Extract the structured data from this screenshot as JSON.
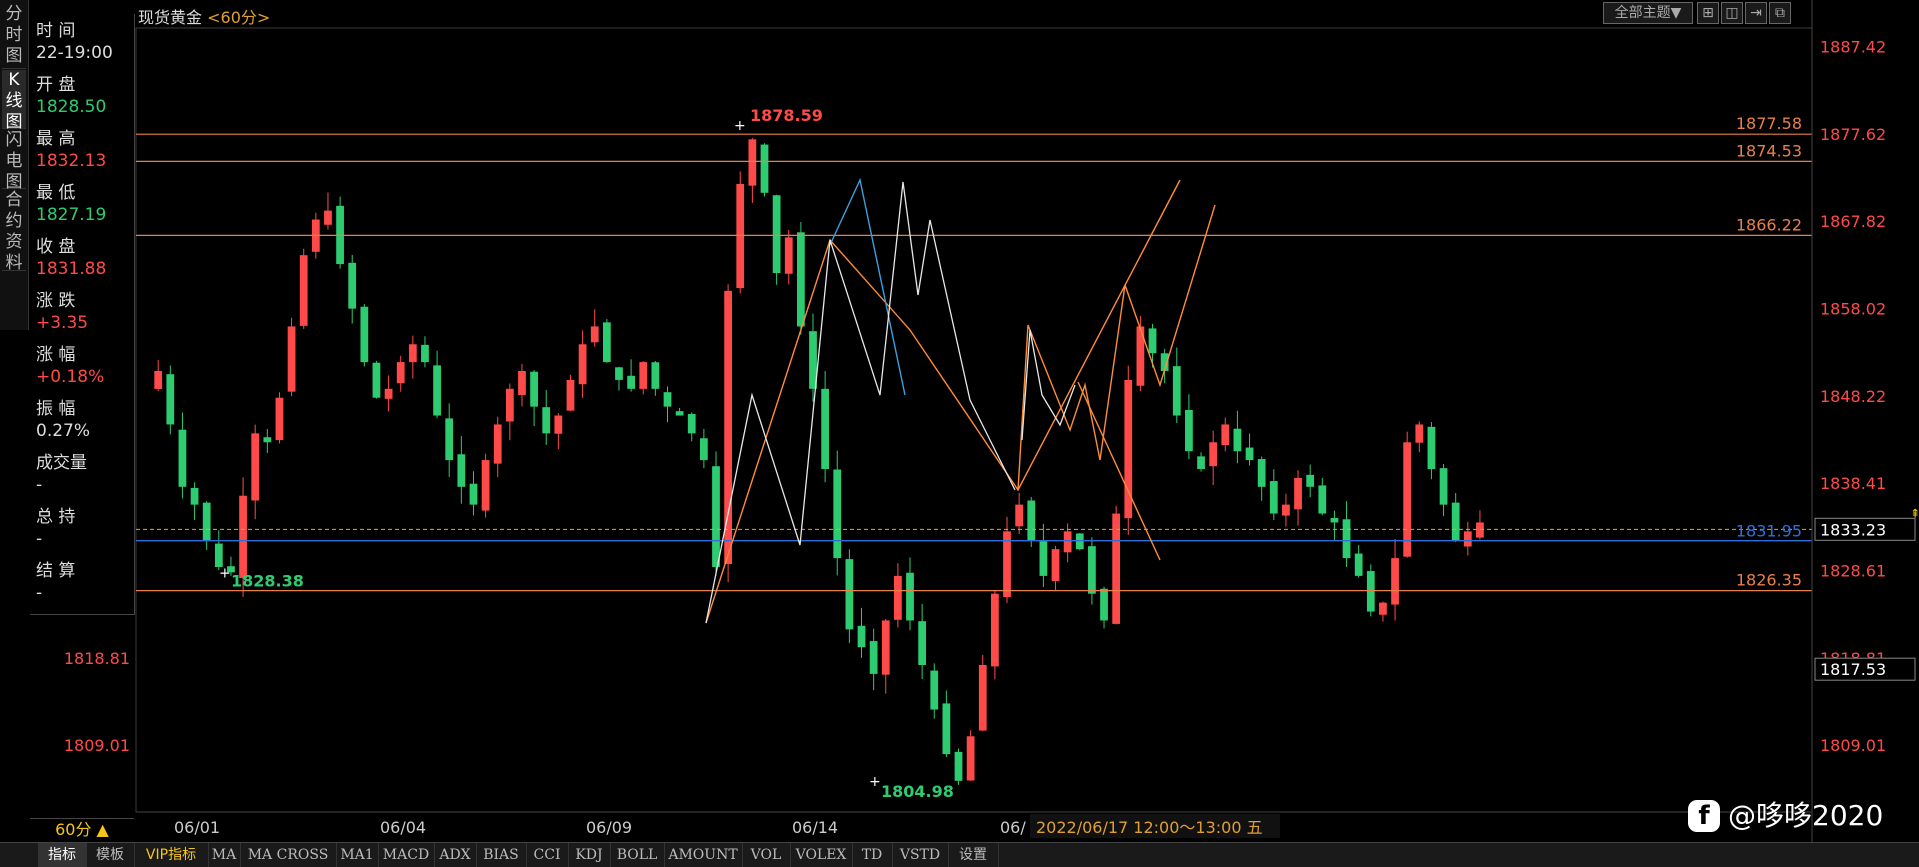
{
  "side_tabs": [
    "分时图",
    "K线图",
    "闪电图",
    "合约资料"
  ],
  "info_panel": [
    {
      "label": "时 间",
      "value": "22-19:00",
      "color": "#dddddd"
    },
    {
      "label": "开 盘",
      "value": "1828.50",
      "color": "#2ecc71"
    },
    {
      "label": "最 高",
      "value": "1832.13",
      "color": "#ff4a4a"
    },
    {
      "label": "最 低",
      "value": "1827.19",
      "color": "#2ecc71"
    },
    {
      "label": "收 盘",
      "value": "1831.88",
      "color": "#ff4a4a"
    },
    {
      "label": "涨 跌",
      "value": "+3.35",
      "color": "#ff4a4a"
    },
    {
      "label": "涨 幅",
      "value": "+0.18%",
      "color": "#ff4a4a"
    },
    {
      "label": "振 幅",
      "value": "0.27%",
      "color": "#dddddd"
    },
    {
      "label": "成交量",
      "value": "-",
      "color": "#dddddd"
    },
    {
      "label": "总 持",
      "value": "-",
      "color": "#dddddd"
    },
    {
      "label": "结 算",
      "value": "-",
      "color": "#dddddd"
    }
  ],
  "chart_header": {
    "symbol": "现货黄金",
    "period": "<60分>"
  },
  "top_buttons": {
    "theme_select": "全部主题▼",
    "icons": [
      "layout-grid-icon",
      "split-view-icon",
      "pin-icon",
      "expand-icon"
    ]
  },
  "colors": {
    "up": "#ff4a4a",
    "down": "#2ecc71",
    "line_level": "#e8804a",
    "line_current": "#2a6fdb",
    "axis_label": "#ff4a4a"
  },
  "chart_data": {
    "type": "candlestick",
    "title": "现货黄金",
    "period": "60分",
    "y_ticks_right": [
      "1887.42",
      "1877.62",
      "1867.82",
      "1858.02",
      "1848.22",
      "1838.41",
      "1828.61",
      "1818.81",
      "1809.01"
    ],
    "y_ticks_left": [
      "1818.81",
      "1809.01"
    ],
    "ylim": [
      1801.5,
      1889.5
    ],
    "x_ticks": [
      "06/01",
      "06/04",
      "06/09",
      "06/14",
      "06/"
    ],
    "cursor_time_label": "2022/06/17 12:00～13:00 五",
    "current_price": "1833.23",
    "hover_price": "1817.53",
    "horizontal_levels": [
      {
        "value": 1877.58,
        "label": "1877.58"
      },
      {
        "value": 1874.53,
        "label": "1874.53"
      },
      {
        "value": 1866.22,
        "label": "1866.22"
      },
      {
        "value": 1826.35,
        "label": "1826.35"
      }
    ],
    "current_line": {
      "value": 1831.95,
      "label": "1831.95"
    },
    "marked_prices": [
      {
        "label": "1878.59",
        "value": 1878.59
      },
      {
        "label": "1828.38",
        "value": 1828.38
      },
      {
        "label": "1804.98",
        "value": 1804.98
      }
    ],
    "close_path": [
      1849,
      1851,
      1845,
      1838,
      1836,
      1832,
      1829,
      1828.4,
      1837,
      1844,
      1843,
      1848,
      1856,
      1864,
      1868,
      1869,
      1863,
      1858,
      1852,
      1848,
      1849,
      1852,
      1854,
      1852,
      1846,
      1841,
      1838,
      1836,
      1841,
      1845,
      1849,
      1851,
      1847,
      1844,
      1846,
      1850,
      1854,
      1856,
      1852,
      1850,
      1849,
      1852,
      1849,
      1847,
      1846,
      1844,
      1841,
      1829,
      1860,
      1872,
      1877,
      1871,
      1862,
      1866,
      1856,
      1849,
      1840,
      1830,
      1822,
      1820,
      1817,
      1823,
      1828,
      1823,
      1818,
      1813,
      1808,
      1805,
      1810,
      1818,
      1826,
      1833,
      1836,
      1832,
      1828,
      1831,
      1833,
      1831,
      1826,
      1823,
      1835,
      1850,
      1856,
      1853,
      1851,
      1846,
      1842,
      1840,
      1843,
      1845,
      1842,
      1841,
      1838,
      1835,
      1836,
      1839,
      1838,
      1835,
      1834,
      1830,
      1828,
      1824,
      1825,
      1830,
      1843,
      1845,
      1840,
      1836,
      1832,
      1833,
      1834
    ],
    "dashed_level": 1833.23
  },
  "drawing_lines": {
    "orange": [
      [
        [
          706,
          623
        ],
        [
          830,
          240
        ],
        [
          910,
          330
        ],
        [
          1018,
          490
        ],
        [
          1180,
          180
        ]
      ],
      [
        [
          1018,
          490
        ],
        [
          1028,
          325
        ],
        [
          1048,
          375
        ],
        [
          1070,
          430
        ],
        [
          1085,
          385
        ],
        [
          1100,
          460
        ],
        [
          1125,
          285
        ],
        [
          1160,
          385
        ],
        [
          1215,
          205
        ]
      ],
      [
        [
          1078,
          382
        ],
        [
          1160,
          560
        ]
      ]
    ],
    "blue": [
      [
        [
          830,
          245
        ],
        [
          860,
          180
        ],
        [
          905,
          395
        ]
      ]
    ],
    "white": [
      [
        [
          706,
          623
        ],
        [
          752,
          395
        ],
        [
          800,
          545
        ],
        [
          830,
          240
        ],
        [
          880,
          395
        ],
        [
          903,
          182
        ],
        [
          918,
          295
        ],
        [
          930,
          220
        ],
        [
          970,
          400
        ],
        [
          1015,
          490
        ]
      ],
      [
        [
          1022,
          440
        ],
        [
          1030,
          330
        ],
        [
          1042,
          395
        ],
        [
          1060,
          425
        ],
        [
          1075,
          385
        ]
      ]
    ]
  },
  "bottom_tabs": [
    "指标",
    "模板",
    "VIP指标",
    "MA",
    "MA CROSS",
    "MA1",
    "MACD",
    "ADX",
    "BIAS",
    "CCI",
    "KDJ",
    "BOLL",
    "AMOUNT",
    "VOL",
    "VOLEX",
    "TD",
    "VSTD",
    "设置"
  ],
  "period_button": "60分 ▲",
  "watermark": {
    "icon": "f",
    "text": "@哆哆2020"
  }
}
